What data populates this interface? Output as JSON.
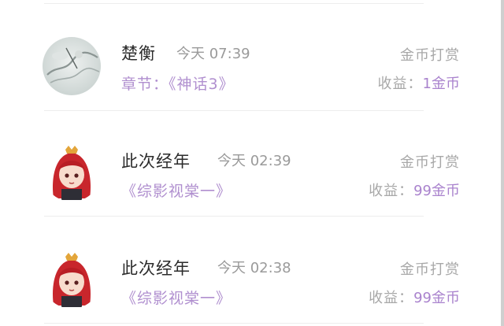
{
  "records": [
    {
      "name": "楚衡",
      "time": "今天 07:39",
      "type": "金币打赏",
      "chapter_prefix": "章节：",
      "work": "《神话3》",
      "earning_label": "收益：",
      "earning_value": "1金币",
      "avatar_icon": "ink-landscape-avatar"
    },
    {
      "name": "此次经年",
      "time": "今天 02:39",
      "type": "金币打赏",
      "chapter_prefix": "",
      "work": "《综影视棠一》",
      "earning_label": "收益：",
      "earning_value": "99金币",
      "avatar_icon": "red-hair-character-avatar"
    },
    {
      "name": "此次经年",
      "time": "今天 02:38",
      "type": "金币打赏",
      "chapter_prefix": "",
      "work": "《综影视棠一》",
      "earning_label": "收益：",
      "earning_value": "99金币",
      "avatar_icon": "red-hair-character-avatar"
    }
  ],
  "colors": {
    "accent": "#b08fcf",
    "accent_value": "#a982cd",
    "name": "#2b2b2b",
    "muted": "#a8a8a8"
  }
}
